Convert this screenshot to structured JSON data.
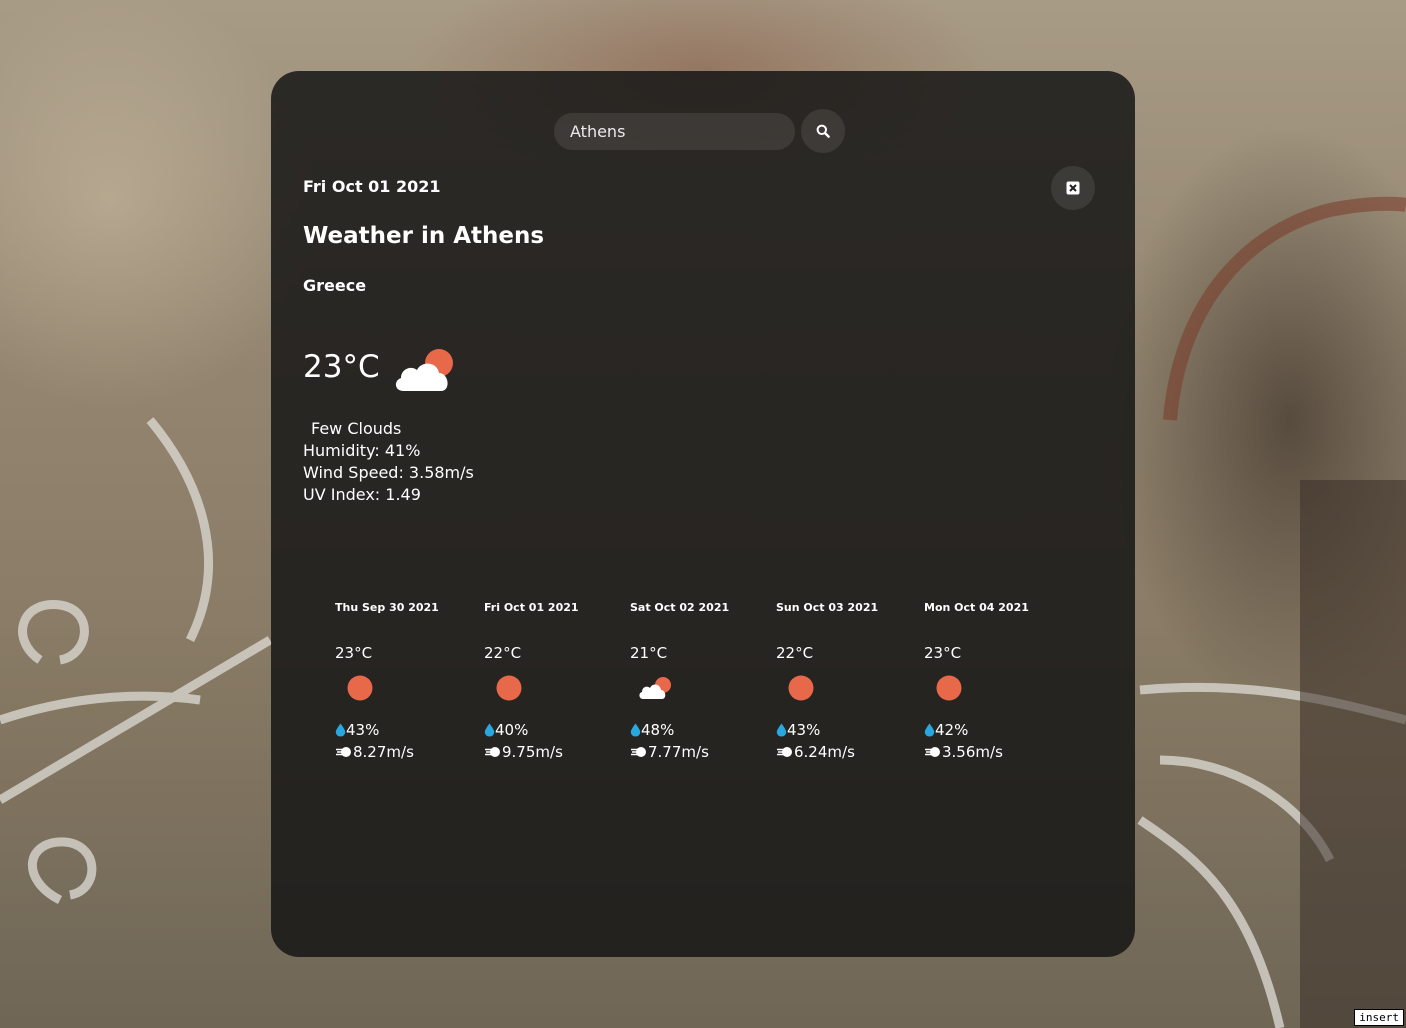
{
  "search": {
    "value": "Athens"
  },
  "current": {
    "date": "Fri Oct 01 2021",
    "title": "Weather in Athens",
    "country": "Greece",
    "temperature": "23°C",
    "icon": "few-clouds-icon",
    "description": "Few Clouds",
    "humidity": "Humidity: 41%",
    "wind": "Wind Speed: 3.58m/s",
    "uv": "UV Index: 1.49"
  },
  "forecast": [
    {
      "date": "Thu Sep 30 2021",
      "temp": "23°C",
      "icon": "sun-icon",
      "humidity": "43%",
      "wind": "8.27m/s"
    },
    {
      "date": "Fri Oct 01 2021",
      "temp": "22°C",
      "icon": "sun-icon",
      "humidity": "40%",
      "wind": "9.75m/s"
    },
    {
      "date": "Sat Oct 02 2021",
      "temp": "21°C",
      "icon": "few-clouds-icon",
      "humidity": "48%",
      "wind": "7.77m/s"
    },
    {
      "date": "Sun Oct 03 2021",
      "temp": "22°C",
      "icon": "sun-icon",
      "humidity": "43%",
      "wind": "6.24m/s"
    },
    {
      "date": "Mon Oct 04 2021",
      "temp": "23°C",
      "icon": "sun-icon",
      "humidity": "42%",
      "wind": "3.56m/s"
    }
  ],
  "colors": {
    "sun": "#e8684a",
    "droplet": "#29a8e0",
    "card": "rgba(20,20,20,0.84)"
  },
  "status": {
    "mode_badge": "insert"
  }
}
